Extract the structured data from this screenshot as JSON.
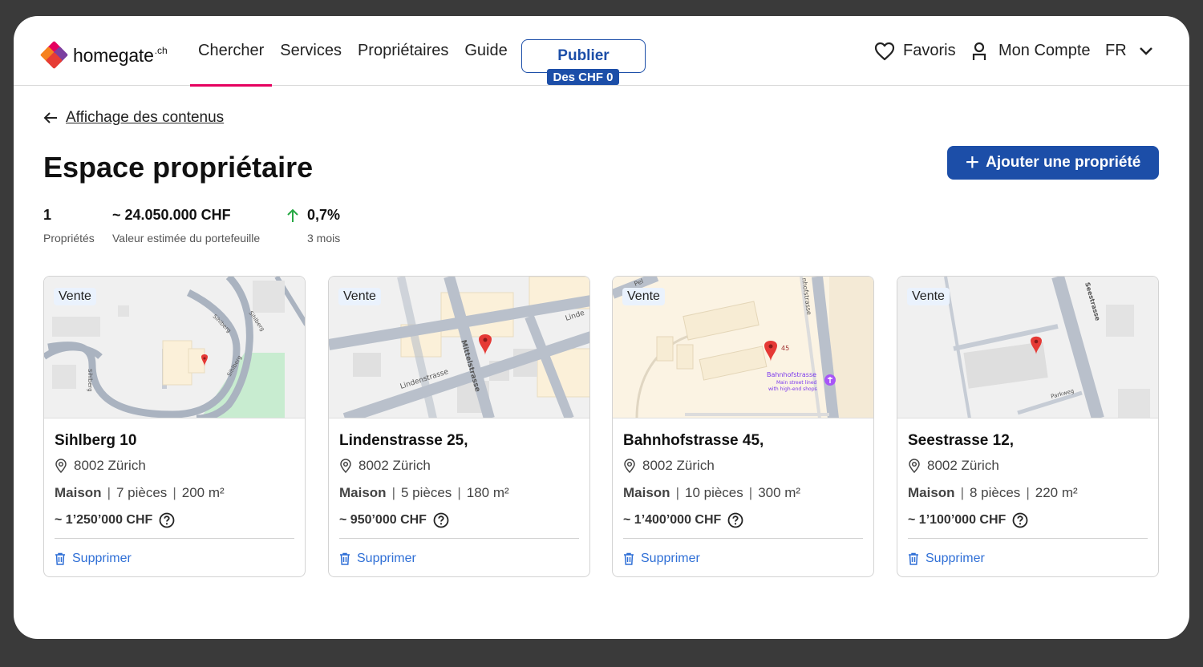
{
  "brand": {
    "name": "homegate",
    "tld": ".ch",
    "colors": {
      "pink": "#e5005f",
      "orange": "#f6821f",
      "purple": "#7b3fa0",
      "red": "#e63c35"
    }
  },
  "nav": {
    "items": [
      {
        "label": "Chercher",
        "active": true
      },
      {
        "label": "Services",
        "active": false
      },
      {
        "label": "Propriétaires",
        "active": false
      },
      {
        "label": "Guide",
        "active": false
      }
    ],
    "publish": {
      "label": "Publier",
      "badge": "Des CHF 0"
    },
    "favorites": "Favoris",
    "account": "Mon Compte",
    "language": "FR"
  },
  "back_link": "Affichage des contenus",
  "page_title": "Espace propriétaire",
  "add_button": "Ajouter une propriété",
  "stats": [
    {
      "value": "1",
      "label": "Propriétés"
    },
    {
      "value": "~ 24.050.000 CHF",
      "label": "Valeur estimée du portefeuille"
    },
    {
      "value": "0,7%",
      "label": "3 mois",
      "trend": "up"
    }
  ],
  "cards": [
    {
      "tag": "Vente",
      "address": "Sihlberg 10",
      "city": "8002 Zürich",
      "type": "Maison",
      "rooms": "7 pièces",
      "area": "200 m²",
      "price": "~ 1’250’000 CHF",
      "delete": "Supprimer",
      "map_labels": [
        "Sihlberg",
        "Sihlberg",
        "Sihlberg",
        "Sihlberg"
      ]
    },
    {
      "tag": "Vente",
      "address": "Lindenstrasse 25,",
      "city": "8002 Zürich",
      "type": "Maison",
      "rooms": "5 pièces",
      "area": "180 m²",
      "price": "~ 950’000 CHF",
      "delete": "Supprimer",
      "map_labels": [
        "Lindenstrasse",
        "Mittelstrasse",
        "Linde"
      ]
    },
    {
      "tag": "Vente",
      "address": "Bahnhofstrasse 45,",
      "city": "8002 Zürich",
      "type": "Maison",
      "rooms": "10 pièces",
      "area": "300 m²",
      "price": "~ 1’400’000 CHF",
      "delete": "Supprimer",
      "map_labels": [
        "Bahnhofstrasse",
        "Main street lined",
        "with high-end shops",
        "45",
        "Pel",
        "nhofstrasse"
      ]
    },
    {
      "tag": "Vente",
      "address": "Seestrasse 12,",
      "city": "8002 Zürich",
      "type": "Maison",
      "rooms": "8 pièces",
      "area": "220 m²",
      "price": "~ 1’100’000 CHF",
      "delete": "Supprimer",
      "map_labels": [
        "Seestrasse",
        "Parkweg"
      ]
    }
  ]
}
